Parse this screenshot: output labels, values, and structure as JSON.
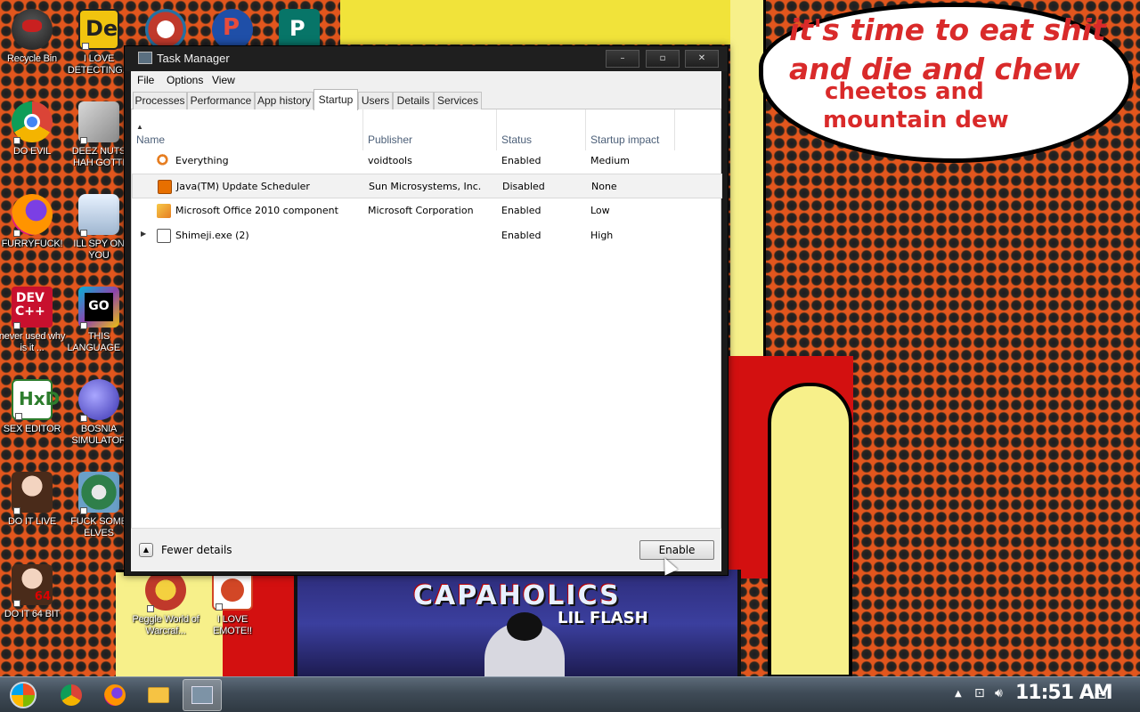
{
  "wallpaper": {
    "speech_line1": "it's time to eat shit",
    "speech_line2": "and die and chew",
    "speech_line3": "cheetos and",
    "speech_line4": "mountain dew",
    "album_title": "CAPAHOLICS",
    "album_subtitle": "LIL FLASH"
  },
  "desktop_icons": [
    {
      "label": "Recycle Bin"
    },
    {
      "label": "I LOVE DETECTING..."
    },
    {
      "label": "DO EVIL"
    },
    {
      "label": "DEEZ NUTS HAH GOTTI"
    },
    {
      "label": "FURRYFUCK!"
    },
    {
      "label": "ILL SPY ON YOU"
    },
    {
      "label": "never used why is it ..."
    },
    {
      "label": "THIS LANGUAGE ..."
    },
    {
      "label": "SEX EDITOR"
    },
    {
      "label": "BOSNIA SIMULATOR"
    },
    {
      "label": "DO IT LIVE"
    },
    {
      "label": "FUCK SOME ELVES"
    },
    {
      "label": "DO IT 64 BIT"
    },
    {
      "label": "Peggle World of Warcraf..."
    },
    {
      "label": "I LOVE EMOTE!!"
    }
  ],
  "taskmanager": {
    "title": "Task Manager",
    "minimize": "–",
    "maximize": "▫",
    "close": "✕",
    "menu": [
      "File",
      "Options",
      "View"
    ],
    "tabs": [
      "Processes",
      "Performance",
      "App history",
      "Startup",
      "Users",
      "Details",
      "Services"
    ],
    "active_tab": "Startup",
    "columns": [
      "Name",
      "Publisher",
      "Status",
      "Startup impact"
    ],
    "rows": [
      {
        "name": "Everything",
        "publisher": "voidtools",
        "status": "Enabled",
        "impact": "Medium"
      },
      {
        "name": "Java(TM) Update Scheduler",
        "publisher": "Sun Microsystems, Inc.",
        "status": "Disabled",
        "impact": "None"
      },
      {
        "name": "Microsoft Office 2010 component",
        "publisher": "Microsoft Corporation",
        "status": "Enabled",
        "impact": "Low"
      },
      {
        "name": "Shimeji.exe (2)",
        "publisher": "",
        "status": "Enabled",
        "impact": "High"
      }
    ],
    "fewer_details": "Fewer details",
    "enable_button": "Enable"
  },
  "taskbar": {
    "clock": "11:51 AM"
  },
  "colors": {
    "wallpaper_orange": "#e2561d",
    "selected_row": "#f2f2f2",
    "header_text": "#4d6079"
  }
}
